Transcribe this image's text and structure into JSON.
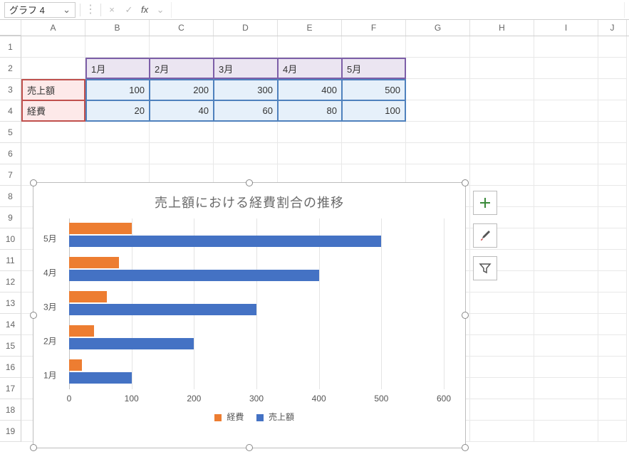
{
  "name_box": "グラフ 4",
  "formula_bar": {
    "x_label": "×",
    "check_label": "✓",
    "fx_label": "fx",
    "value": ""
  },
  "columns": [
    "A",
    "B",
    "C",
    "D",
    "E",
    "F",
    "G",
    "H",
    "I",
    "J"
  ],
  "row_numbers": [
    1,
    2,
    3,
    4,
    5,
    6,
    7,
    8,
    9,
    10,
    11,
    12,
    13,
    14,
    15,
    16,
    17,
    18,
    19
  ],
  "table": {
    "headers": [
      "1月",
      "2月",
      "3月",
      "4月",
      "5月"
    ],
    "row_labels": [
      "売上額",
      "経費"
    ],
    "values": [
      [
        100,
        200,
        300,
        400,
        500
      ],
      [
        20,
        40,
        60,
        80,
        100
      ]
    ]
  },
  "chart_data": {
    "type": "bar",
    "title": "売上額における経費割合の推移",
    "categories": [
      "5月",
      "4月",
      "3月",
      "2月",
      "1月"
    ],
    "series": [
      {
        "name": "経費",
        "color": "#ED7D31",
        "values": [
          100,
          80,
          60,
          40,
          20
        ]
      },
      {
        "name": "売上額",
        "color": "#4472C4",
        "values": [
          500,
          400,
          300,
          200,
          100
        ]
      }
    ],
    "xlim": [
      0,
      600
    ],
    "xticks": [
      0,
      100,
      200,
      300,
      400,
      500,
      600
    ],
    "legend": [
      "経費",
      "売上額"
    ],
    "legend_position": "bottom",
    "grid": true
  },
  "chart_tools": {
    "add": "+",
    "style": "brush-icon",
    "filter": "filter-icon"
  }
}
